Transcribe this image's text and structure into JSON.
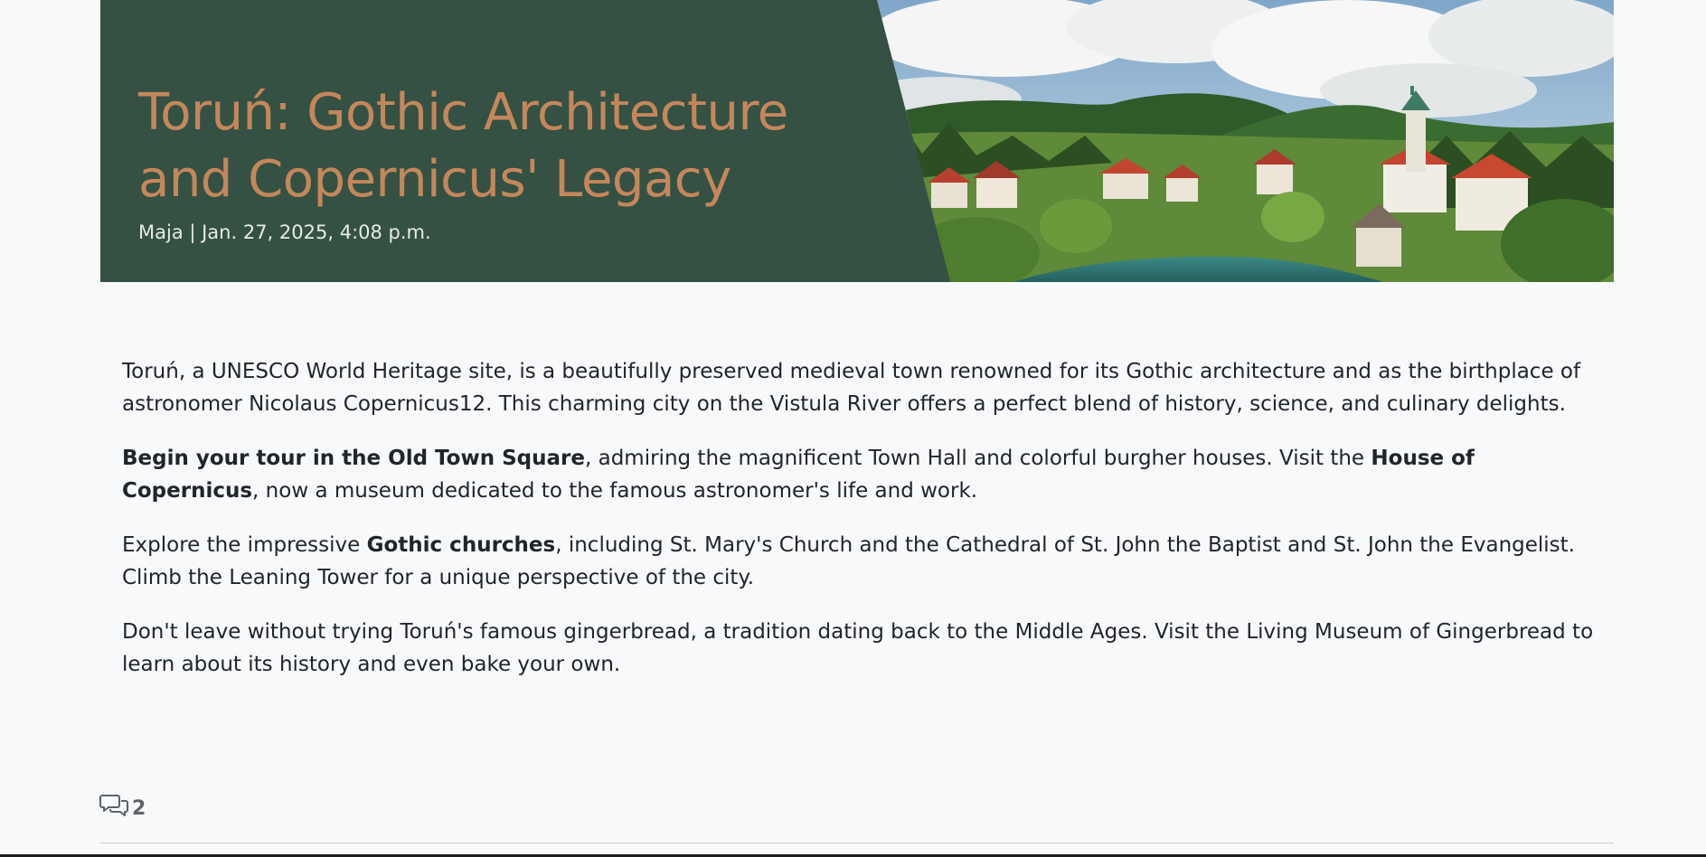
{
  "post": {
    "title": "Toruń: Gothic Architecture and Copernicus' Legacy",
    "meta": "Maja | Jan. 27, 2025, 4:08 p.m.",
    "paragraphs": [
      {
        "segments": [
          {
            "text": "Toruń, a UNESCO World Heritage site, is a beautifully preserved medieval town renowned for its Gothic architecture and as the birthplace of astronomer Nicolaus Copernicus12. This charming city on the Vistula River offers a perfect blend of history, science, and culinary delights.",
            "bold": false
          }
        ]
      },
      {
        "segments": [
          {
            "text": "Begin your tour in the Old Town Square",
            "bold": true
          },
          {
            "text": ", admiring the magnificent Town Hall and colorful burgher houses. Visit the ",
            "bold": false
          },
          {
            "text": "House of Copernicus",
            "bold": true
          },
          {
            "text": ", now a museum dedicated to the famous astronomer's life and work.",
            "bold": false
          }
        ]
      },
      {
        "segments": [
          {
            "text": "Explore the impressive ",
            "bold": false
          },
          {
            "text": "Gothic churches",
            "bold": true
          },
          {
            "text": ", including St. Mary's Church and the Cathedral of St. John the Baptist and St. John the Evangelist. Climb the Leaning Tower for a unique perspective of the city.",
            "bold": false
          }
        ]
      },
      {
        "segments": [
          {
            "text": "Don't leave without trying Toruń's famous gingerbread, a tradition dating back to the Middle Ages. Visit the Living Museum of Gingerbread to learn about its history and even bake your own.",
            "bold": false
          }
        ]
      }
    ]
  },
  "comments": {
    "icon": "chat-bubbles-icon",
    "count": "2"
  },
  "colors": {
    "hero_background": "#355143",
    "title": "#c4875c",
    "meta": "#e6ebe7",
    "body_text": "#212529"
  }
}
